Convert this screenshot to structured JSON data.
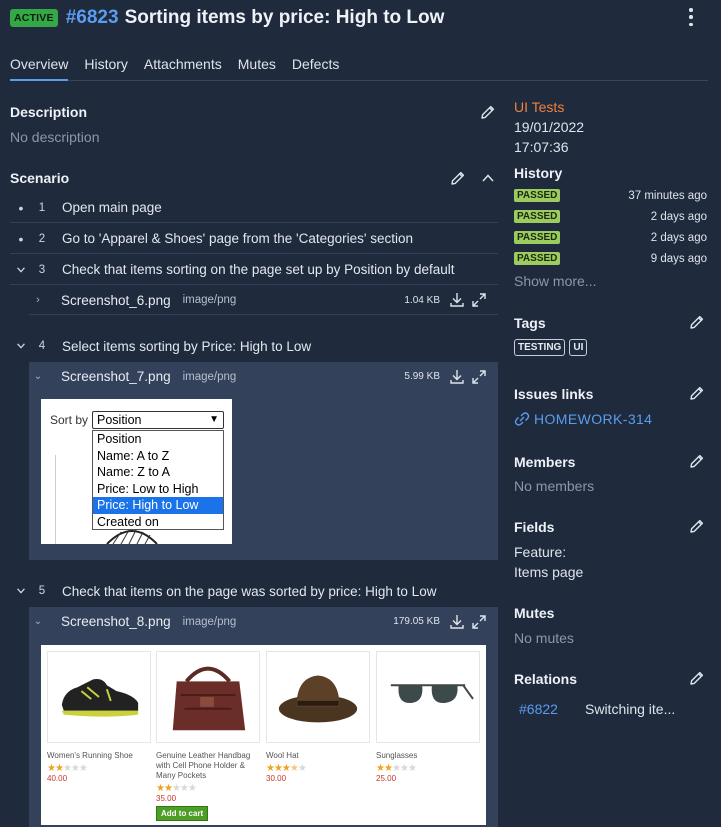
{
  "header": {
    "status_badge": "ACTIVE",
    "id": "#6823",
    "title": "Sorting items by price: High to Low"
  },
  "tabs": [
    {
      "label": "Overview",
      "active": true
    },
    {
      "label": "History"
    },
    {
      "label": "Attachments"
    },
    {
      "label": "Mutes"
    },
    {
      "label": "Defects"
    }
  ],
  "description": {
    "title": "Description",
    "value": "No description"
  },
  "scenario": {
    "title": "Scenario",
    "steps": [
      {
        "num": "1",
        "text": "Open main page"
      },
      {
        "num": "2",
        "text": "Go to  'Apparel & Shoes' page from the 'Categories' section"
      },
      {
        "num": "3",
        "text": "Check that items sorting on the page set up by Position by default",
        "attachment": {
          "name": "Screenshot_6.png",
          "type": "image/png",
          "size": "1.04 KB"
        }
      },
      {
        "num": "4",
        "text": "Select items sorting by Price: High to Low",
        "attachment": {
          "name": "Screenshot_7.png",
          "type": "image/png",
          "size": "5.99 KB"
        }
      },
      {
        "num": "5",
        "text": "Check that items on the page was sorted by price: High to Low",
        "attachment": {
          "name": "Screenshot_8.png",
          "type": "image/png",
          "size": "179.05 KB"
        }
      }
    ],
    "shot7": {
      "sort_label": "Sort by",
      "selected": "Position",
      "options": [
        "Position",
        "Name: A to Z",
        "Name: Z to A",
        "Price: Low to High",
        "Price: High to Low",
        "Created on"
      ],
      "highlighted": "Price: High to Low"
    },
    "shot8": {
      "products": [
        {
          "name": "Women's Running Shoe",
          "rating": 2,
          "price": "40.00"
        },
        {
          "name": "Genuine Leather Handbag with Cell Phone Holder & Many Pockets",
          "rating": 2,
          "price": "35.00",
          "button": "Add to cart"
        },
        {
          "name": "Wool Hat",
          "rating": 3.5,
          "price": "30.00"
        },
        {
          "name": "Sunglasses",
          "rating": 2,
          "price": "25.00"
        }
      ]
    }
  },
  "sidebar": {
    "layer": "UI Tests",
    "date": "19/01/2022",
    "time": "17:07:36",
    "history": {
      "title": "History",
      "items": [
        {
          "status": "PASSED",
          "time": "37 minutes ago"
        },
        {
          "status": "PASSED",
          "time": "2 days ago"
        },
        {
          "status": "PASSED",
          "time": "2 days ago"
        },
        {
          "status": "PASSED",
          "time": "9 days ago"
        }
      ],
      "show_more": "Show more..."
    },
    "tags": {
      "title": "Tags",
      "items": [
        "TESTING",
        "UI"
      ]
    },
    "issues": {
      "title": "Issues links",
      "link": "HOMEWORK-314"
    },
    "members": {
      "title": "Members",
      "value": "No members"
    },
    "fields": {
      "title": "Fields",
      "key": "Feature:",
      "value": "Items page"
    },
    "mutes": {
      "title": "Mutes",
      "value": "No mutes"
    },
    "relations": {
      "title": "Relations",
      "id": "#6822",
      "name": "Switching ite..."
    }
  },
  "colors": {
    "accent": "#5b9cf0",
    "passed": "#9ccc5f",
    "active": "#33a845",
    "layer": "#f0823c"
  }
}
